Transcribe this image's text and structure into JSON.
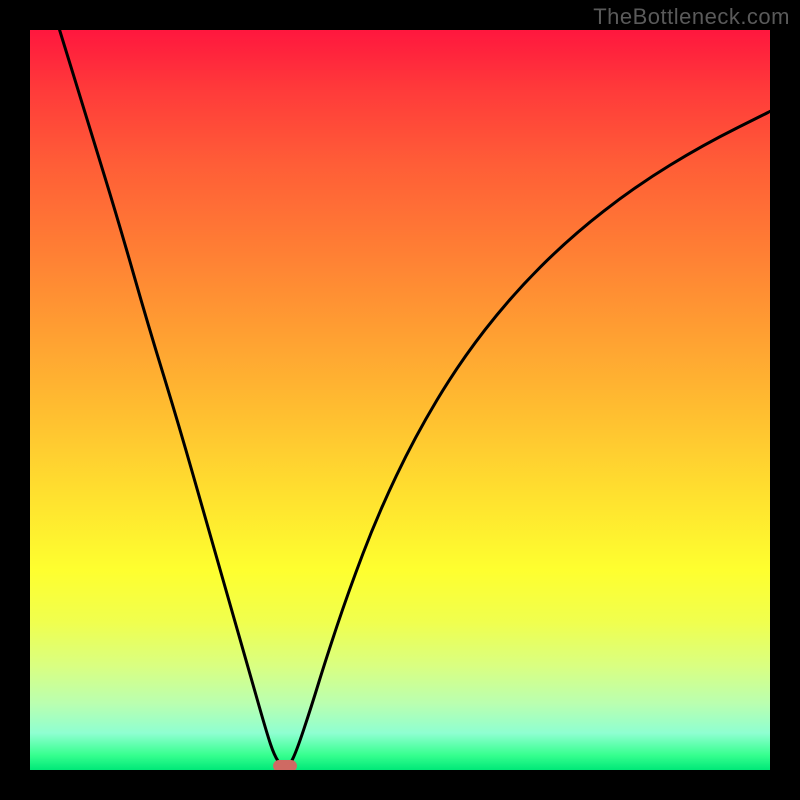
{
  "watermark": "TheBottleneck.com",
  "chart_data": {
    "type": "line",
    "title": "",
    "xlabel": "",
    "ylabel": "",
    "xlim": [
      0,
      1
    ],
    "ylim": [
      0,
      1
    ],
    "gradient_stops": [
      {
        "pos": 0.0,
        "color": "#ff173e"
      },
      {
        "pos": 0.08,
        "color": "#ff3a3a"
      },
      {
        "pos": 0.18,
        "color": "#ff5d37"
      },
      {
        "pos": 0.3,
        "color": "#ff7f34"
      },
      {
        "pos": 0.42,
        "color": "#ffa232"
      },
      {
        "pos": 0.53,
        "color": "#ffc230"
      },
      {
        "pos": 0.63,
        "color": "#ffe12f"
      },
      {
        "pos": 0.73,
        "color": "#feff2f"
      },
      {
        "pos": 0.8,
        "color": "#f0ff4e"
      },
      {
        "pos": 0.86,
        "color": "#d9ff82"
      },
      {
        "pos": 0.91,
        "color": "#baffb0"
      },
      {
        "pos": 0.95,
        "color": "#8fffd1"
      },
      {
        "pos": 0.98,
        "color": "#36ff8f"
      },
      {
        "pos": 1.0,
        "color": "#00e878"
      }
    ],
    "series": [
      {
        "name": "curve",
        "x": [
          0.04,
          0.08,
          0.12,
          0.16,
          0.2,
          0.24,
          0.28,
          0.3,
          0.32,
          0.33,
          0.34,
          0.345,
          0.35,
          0.36,
          0.38,
          0.4,
          0.43,
          0.47,
          0.52,
          0.58,
          0.65,
          0.73,
          0.82,
          0.91,
          1.0
        ],
        "y": [
          1.0,
          0.87,
          0.74,
          0.6,
          0.47,
          0.33,
          0.19,
          0.12,
          0.05,
          0.02,
          0.005,
          0.0,
          0.005,
          0.025,
          0.085,
          0.15,
          0.24,
          0.345,
          0.45,
          0.55,
          0.64,
          0.72,
          0.79,
          0.845,
          0.89
        ]
      }
    ],
    "marker": {
      "x": 0.345,
      "y": 0.0,
      "color": "#cf6a63"
    }
  }
}
